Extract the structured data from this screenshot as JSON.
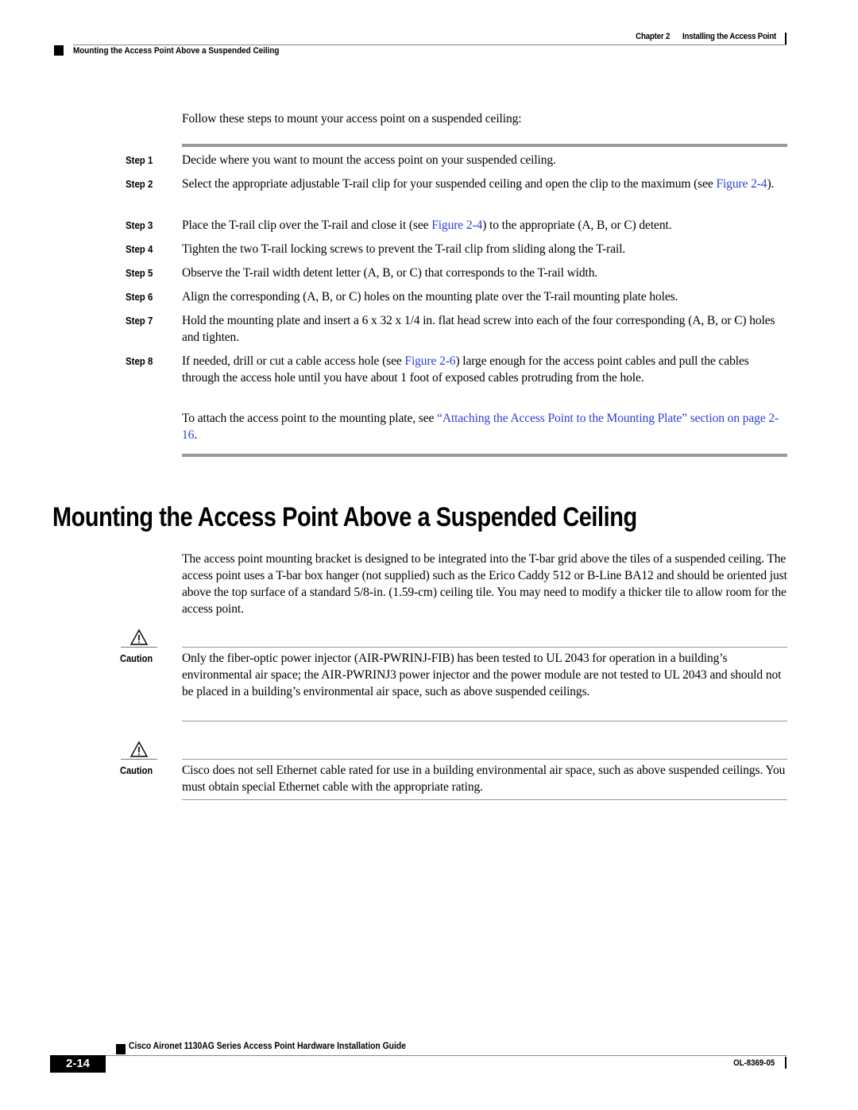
{
  "header": {
    "chapter": "Chapter 2",
    "chapter_title": "Installing the Access Point",
    "section": "Mounting the Access Point Above a Suspended Ceiling"
  },
  "procedure": {
    "intro": "Follow these steps to mount your access point on a suspended ceiling:",
    "steps": [
      {
        "label": "Step 1",
        "text": "Decide where you want to mount the access point on your suspended ceiling."
      },
      {
        "label": "Step 2",
        "text_before": "Select the appropriate adjustable T-rail clip for your suspended ceiling and open the clip to the maximum (see ",
        "link": "Figure 2-4",
        "text_after": ")."
      },
      {
        "label": "Step 3",
        "text_before": "Place the T-rail clip over the T-rail and close it (see ",
        "link": "Figure 2-4",
        "text_after": ") to the appropriate (A, B, or C) detent."
      },
      {
        "label": "Step 4",
        "text": "Tighten the two T-rail locking screws to prevent the T-rail clip from sliding along the T-rail."
      },
      {
        "label": "Step 5",
        "text": "Observe the T-rail width detent letter (A, B, or C) that corresponds to the T-rail width."
      },
      {
        "label": "Step 6",
        "text": "Align the corresponding (A, B, or C) holes on the mounting plate over the T-rail mounting plate holes."
      },
      {
        "label": "Step 7",
        "text": "Hold the mounting plate and insert a 6 x 32 x 1/4 in. flat head screw into each of the four corresponding (A, B, or C) holes and tighten."
      },
      {
        "label": "Step 8",
        "text_before": "If needed, drill or cut a cable access hole (see ",
        "link": "Figure 2-6",
        "text_after": ") large enough for the access point cables and pull the cables through the access hole until you have about 1 foot of exposed cables protruding from the hole."
      }
    ],
    "followup_before": "To attach the access point to the mounting plate, see ",
    "followup_link": "“Attaching the Access Point to the Mounting Plate” section on page 2-16",
    "followup_after": "."
  },
  "section": {
    "title": "Mounting the Access Point Above a Suspended Ceiling",
    "body": "The access point mounting bracket is designed to be integrated into the T-bar grid above the tiles of a suspended ceiling. The access point uses a T-bar box hanger (not supplied) such as the Erico Caddy 512 or B-Line BA12 and should be oriented just above the top surface of a standard 5/8-in. (1.59-cm) ceiling tile. You may need to modify a thicker tile to allow room for the access point."
  },
  "cautions": [
    {
      "label": "Caution",
      "icon": "warning-triangle-icon",
      "text": "Only the fiber-optic power injector (AIR-PWRINJ-FIB) has been tested to UL 2043 for operation in a building’s environmental air space; the AIR-PWRINJ3 power injector and the power module are not tested to UL 2043 and should not be placed in a building’s environmental air space, such as above suspended ceilings."
    },
    {
      "label": "Caution",
      "icon": "warning-triangle-icon",
      "text": "Cisco does not sell Ethernet cable rated for use in a building environmental air space, such as above suspended ceilings. You must obtain special Ethernet cable with the appropriate rating."
    }
  ],
  "footer": {
    "guide_title": "Cisco Aironet 1130AG Series Access Point Hardware Installation Guide",
    "page_number": "2-14",
    "doc_number": "OL-8369-05"
  },
  "colors": {
    "link": "#2b3fd6",
    "rule": "#9a9a9a"
  }
}
